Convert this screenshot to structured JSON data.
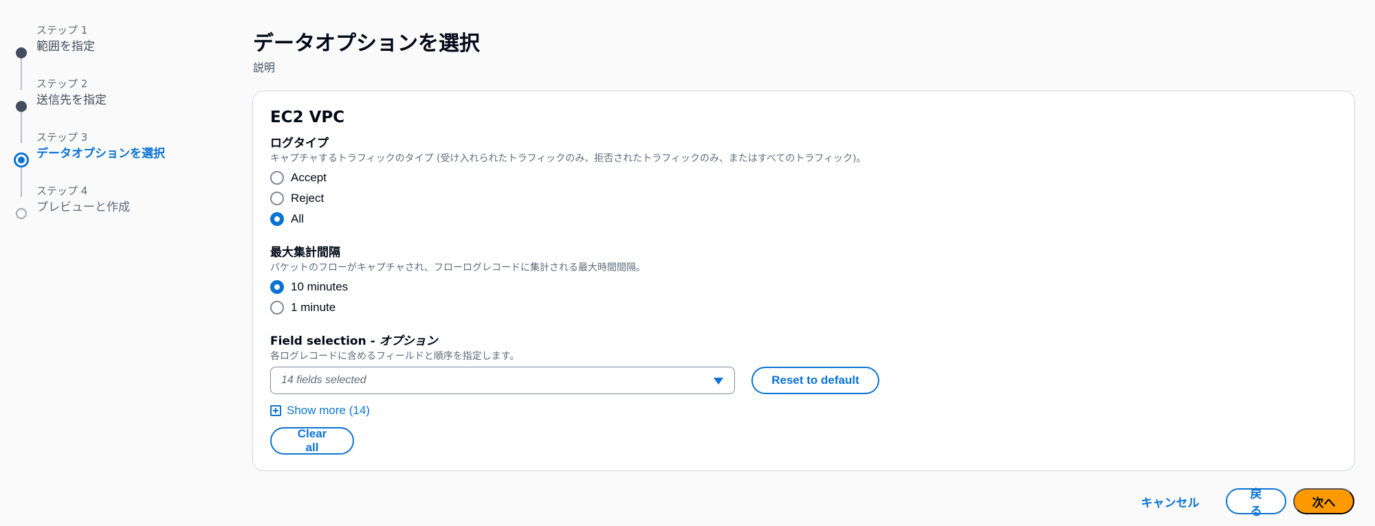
{
  "steps": [
    {
      "num": "ステップ 1",
      "title": "範囲を指定",
      "state": "completed"
    },
    {
      "num": "ステップ 2",
      "title": "送信先を指定",
      "state": "completed"
    },
    {
      "num": "ステップ 3",
      "title": "データオプションを選択",
      "state": "active"
    },
    {
      "num": "ステップ 4",
      "title": "プレビューと作成",
      "state": "pending"
    }
  ],
  "header": {
    "title": "データオプションを選択",
    "description": "説明"
  },
  "card": {
    "title": "EC2 VPC",
    "log_type": {
      "label": "ログタイプ",
      "description": "キャプチャするトラフィックのタイプ (受け入れられたトラフィックのみ、拒否されたトラフィックのみ、またはすべてのトラフィック)。",
      "options": [
        "Accept",
        "Reject",
        "All"
      ],
      "selected": "All"
    },
    "aggregation": {
      "label": "最大集計間隔",
      "description": "パケットのフローがキャプチャされ、フローログレコードに集計される最大時間間隔。",
      "options": [
        "10 minutes",
        "1 minute"
      ],
      "selected": "10 minutes"
    },
    "field_selection": {
      "label": "Field selection - ",
      "optional": "オプション",
      "description": "各ログレコードに含めるフィールドと順序を指定します。",
      "select_value": "14 fields selected",
      "reset_label": "Reset to default",
      "show_more_label": "Show more (14)",
      "clear_label": "Clear all"
    }
  },
  "footer": {
    "cancel_label": "キャンセル",
    "back_label": "戻る",
    "next_label": "次へ"
  },
  "colors": {
    "accent": "#0972d3",
    "primary_button": "#ff9900"
  }
}
